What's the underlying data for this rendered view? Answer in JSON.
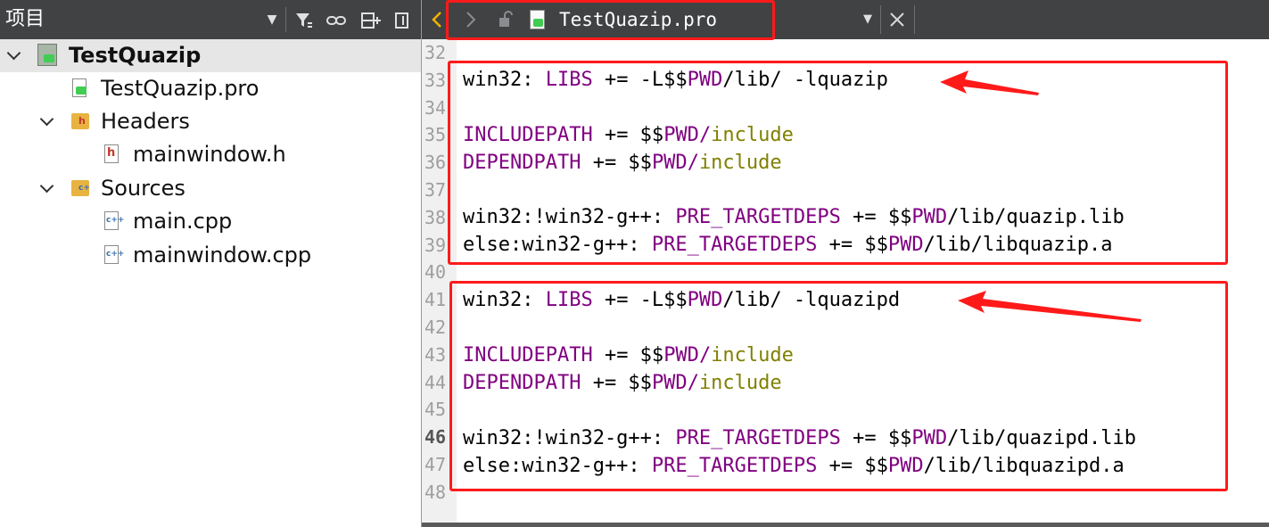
{
  "left_panel": {
    "title": "项目",
    "toolbar_icons": [
      "dropdown-icon",
      "filter-icon",
      "link-icon",
      "split-icon",
      "close-panel-icon"
    ],
    "tree": [
      {
        "label": "TestQuazip",
        "kind": "project",
        "expanded": true,
        "selected": true
      },
      {
        "label": "TestQuazip.pro",
        "kind": "pro-file"
      },
      {
        "label": "Headers",
        "kind": "folder",
        "expanded": true
      },
      {
        "label": "mainwindow.h",
        "kind": "header-file"
      },
      {
        "label": "Sources",
        "kind": "folder",
        "expanded": true
      },
      {
        "label": "main.cpp",
        "kind": "cpp-file"
      },
      {
        "label": "mainwindow.cpp",
        "kind": "cpp-file"
      }
    ]
  },
  "editor": {
    "tab_title": "TestQuazip.pro",
    "toolbar_icons": [
      "back-icon",
      "forward-icon",
      "lock-icon",
      "file-icon",
      "dropdown-icon",
      "close-icon"
    ],
    "current_line": "46",
    "line_numbers": [
      "32",
      "33",
      "34",
      "35",
      "36",
      "37",
      "38",
      "39",
      "40",
      "41",
      "42",
      "43",
      "44",
      "45",
      "46",
      "47",
      "48"
    ],
    "code": {
      "l33": {
        "a": "win32: ",
        "b": "LIBS",
        "c": " += -L$$",
        "d": "PWD",
        "e": "/lib/ -lquazip"
      },
      "l35": {
        "a": "INCLUDEPATH",
        "b": " += $$",
        "c": "PWD",
        "d": "/",
        "e": "include"
      },
      "l36": {
        "a": "DEPENDPATH",
        "b": " += $$",
        "c": "PWD",
        "d": "/",
        "e": "include"
      },
      "l38": {
        "a": "win32:!win32-g++: ",
        "b": "PRE_TARGETDEPS",
        "c": " += $$",
        "d": "PWD",
        "e": "/lib/quazip.lib"
      },
      "l39": {
        "a": "else:win32-g++: ",
        "b": "PRE_TARGETDEPS",
        "c": " += $$",
        "d": "PWD",
        "e": "/lib/libquazip.a"
      },
      "l41": {
        "a": "win32: ",
        "b": "LIBS",
        "c": " += -L$$",
        "d": "PWD",
        "e": "/lib/ -lquazipd"
      },
      "l43": {
        "a": "INCLUDEPATH",
        "b": " += $$",
        "c": "PWD",
        "d": "/",
        "e": "include"
      },
      "l44": {
        "a": "DEPENDPATH",
        "b": " += $$",
        "c": "PWD",
        "d": "/",
        "e": "include"
      },
      "l46": {
        "a": "win32:!win32-g++: ",
        "b": "PRE_TARGETDEPS",
        "c": " += $$",
        "d": "PWD",
        "e": "/lib/quazipd.lib"
      },
      "l47": {
        "a": "else:win32-g++: ",
        "b": "PRE_TARGETDEPS",
        "c": " += $$",
        "d": "PWD",
        "e": "/lib/libquazipd.a"
      }
    }
  },
  "colors": {
    "toolbar_bg": "#404244",
    "keyword": "#800080",
    "variable": "#808000",
    "annotation": "#ff1a1a",
    "gutter_bg": "#f0f0f0",
    "selection_bg": "#e6e6e6"
  }
}
